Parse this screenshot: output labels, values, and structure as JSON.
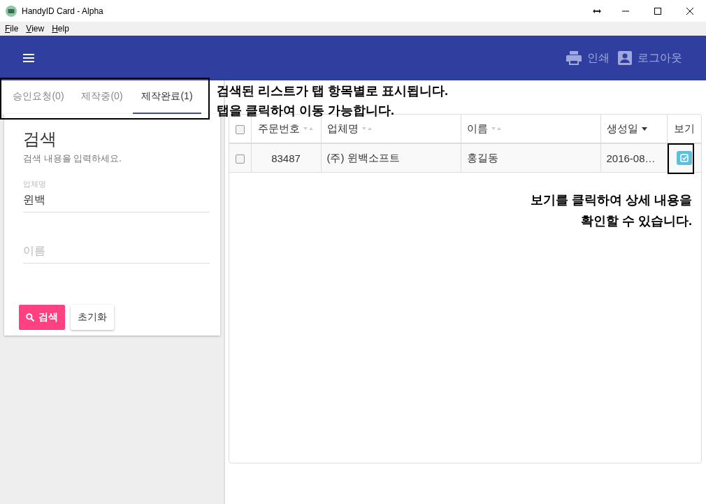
{
  "window": {
    "title": "HandyID Card - Alpha"
  },
  "menu": [
    "File",
    "View",
    "Help"
  ],
  "app_bar": {
    "actions": [
      {
        "label": "인쇄",
        "kind": "print"
      },
      {
        "label": "로그아웃",
        "kind": "account"
      }
    ]
  },
  "tabs": [
    {
      "label": "승인요청(0)",
      "selected": false
    },
    {
      "label": "제작중(0)",
      "selected": false
    },
    {
      "label": "제작완료(1)",
      "selected": true
    }
  ],
  "search_card": {
    "title": "검색",
    "subtitle": "검색 내용을 입력하세요.",
    "fields": [
      {
        "label": "업체명",
        "value": "윈백"
      },
      {
        "placeholder": "이름"
      }
    ],
    "buttons": [
      {
        "label": "검색",
        "kind": "primary"
      },
      {
        "label": "초기화",
        "kind": "secondary"
      }
    ]
  },
  "table": {
    "header_checked": false,
    "columns": [
      {
        "label": "주문번호",
        "sorted": false
      },
      {
        "label": "업체명",
        "sorted": false
      },
      {
        "label": "이름",
        "sorted": false
      },
      {
        "label": "생성일",
        "sorted": true
      },
      {
        "label": "보기"
      }
    ],
    "rows": [
      {
        "checked": false,
        "cells": [
          "83487",
          "(주) 윈백소프트",
          "홍길동",
          "2016-08…"
        ]
      }
    ]
  },
  "callouts": [
    {
      "lines": [
        "검색된 리스트가 탭 항목별로 표시됩니다.",
        "탭을 클릭하여 이동 가능합니다."
      ]
    },
    {
      "lines": [
        "보기를 클릭하여 상세 내용을",
        "확인할 수 있습니다."
      ]
    }
  ]
}
